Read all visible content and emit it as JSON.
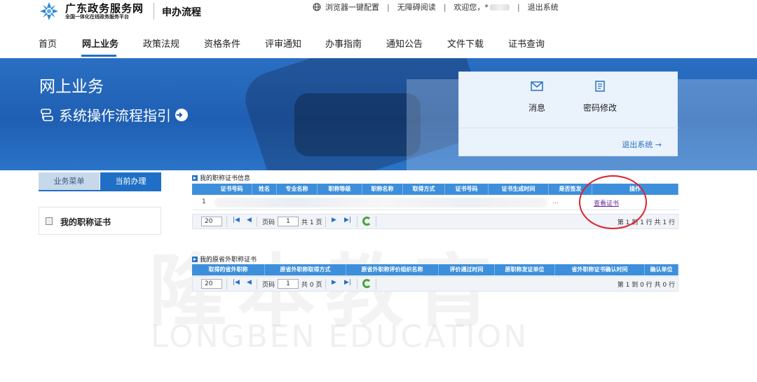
{
  "header": {
    "brand_name": "广东政务服务网",
    "brand_sub": "全国一体化在线政务服务平台",
    "system_name": "申办流程",
    "links": {
      "browser_config": "浏览器一键配置",
      "accessible_reading": "无障碍阅读",
      "welcome": "欢迎您，*",
      "logout": "退出系统"
    }
  },
  "nav": {
    "items": [
      {
        "label": "首页"
      },
      {
        "label": "网上业务"
      },
      {
        "label": "政策法规"
      },
      {
        "label": "资格条件"
      },
      {
        "label": "评审通知"
      },
      {
        "label": "办事指南"
      },
      {
        "label": "通知公告"
      },
      {
        "label": "文件下载"
      },
      {
        "label": "证书查询"
      }
    ],
    "active_index": 1
  },
  "banner": {
    "title": "网上业务",
    "guide": "系统操作流程指引",
    "panel": {
      "messages": "消息",
      "change_password": "密码修改",
      "logout": "退出系统 →"
    }
  },
  "sidebar": {
    "tab_menu": "业务菜单",
    "tab_current": "当前办理",
    "item": "我的职称证书"
  },
  "cert_grid": {
    "title": "我的职称证书信息",
    "columns": [
      "证书号码",
      "姓名",
      "专业名称",
      "职称等级",
      "职称名称",
      "取得方式",
      "证书号码",
      "证书生成时间",
      "是否签发",
      "操作"
    ],
    "rows": [
      {
        "num": "1",
        "signed": "...",
        "action": "查看证书"
      }
    ],
    "pager": {
      "page_size": "20",
      "page_label": "页码",
      "page_value": "1",
      "total_pages": "共 1 页",
      "info": "第 1 到 1 行 共 1 行"
    }
  },
  "external_grid": {
    "title": "我的原省外职称证书",
    "columns": [
      "取得的省外职称",
      "原省外职称取得方式",
      "原省外职称评价组织名称",
      "评价通过时间",
      "原职称发证单位",
      "省外职称证书确认时间",
      "确认单位"
    ],
    "pager": {
      "page_size": "20",
      "page_label": "页码",
      "page_value": "1",
      "total_pages": "共 0 页",
      "info": "第 1 到 0 行 共 0 行"
    }
  },
  "watermark": {
    "cn": "隆本教育",
    "en": "LONGBEN EDUCATION"
  },
  "colors": {
    "primary": "#1f6fc6",
    "grid_header": "#3d8fdb",
    "highlight_circle": "#e0222a"
  },
  "icons": [
    "logo-icon",
    "globe-icon",
    "mail-icon",
    "password-icon",
    "guide-icon",
    "arrow-right-icon",
    "document-icon",
    "refresh-icon"
  ]
}
